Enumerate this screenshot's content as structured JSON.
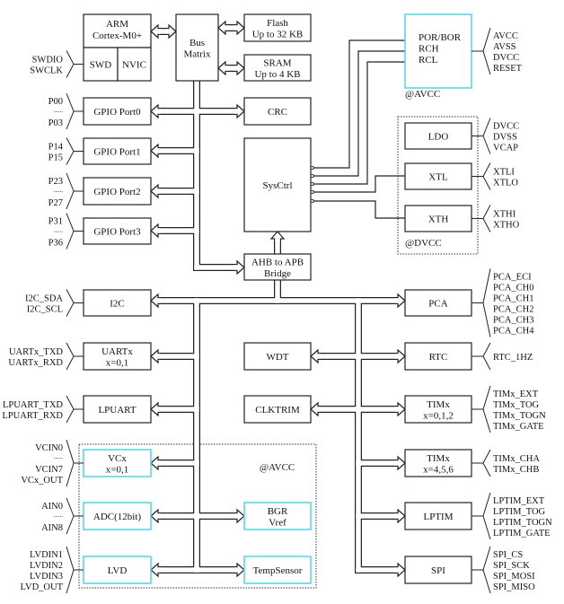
{
  "colors": {
    "line": "#222222",
    "analog_block": "#4fd6e3",
    "background": "#ffffff"
  },
  "blocks": {
    "arm": [
      "ARM",
      "Cortex-M0+"
    ],
    "swd": [
      "SWD"
    ],
    "nvic": [
      "NVIC"
    ],
    "bus_matrix": [
      "Bus",
      "Matrix"
    ],
    "flash": [
      "Flash",
      "Up to 32 KB"
    ],
    "sram": [
      "SRAM",
      "Up to 4 KB"
    ],
    "crc": [
      "CRC"
    ],
    "sysctrl": [
      "SysCtrl"
    ],
    "ahb_apb": [
      "AHB to APB",
      "Bridge"
    ],
    "gpio0": [
      "GPIO Port0"
    ],
    "gpio1": [
      "GPIO Port1"
    ],
    "gpio2": [
      "GPIO Port2"
    ],
    "gpio3": [
      "GPIO Port3"
    ],
    "i2c": [
      "I2C"
    ],
    "uart": [
      "UARTx",
      "x=0,1"
    ],
    "lpuart": [
      "LPUART"
    ],
    "vcx": [
      "VCx",
      "x=0,1"
    ],
    "adc": [
      "ADC(12bit)"
    ],
    "lvd": [
      "LVD"
    ],
    "wdt": [
      "WDT"
    ],
    "clktrim": [
      "CLKTRIM"
    ],
    "bgr": [
      "BGR",
      "Vref"
    ],
    "tempsensor": [
      "TempSensor"
    ],
    "por": [
      "POR/BOR",
      "RCH",
      "RCL"
    ],
    "ldo": [
      "LDO"
    ],
    "xtl": [
      "XTL"
    ],
    "xth": [
      "XTH"
    ],
    "pca": [
      "PCA"
    ],
    "rtc": [
      "RTC"
    ],
    "tim012": [
      "TIMx",
      "x=0,1,2"
    ],
    "tim456": [
      "TIMx",
      "x=4,5,6"
    ],
    "lptim": [
      "LPTIM"
    ],
    "spi": [
      "SPI"
    ]
  },
  "domains": {
    "avcc_top": "@AVCC",
    "dvcc": "@DVCC",
    "avcc_bottom": "@AVCC"
  },
  "pins": {
    "swd": [
      "SWDIO",
      "SWCLK"
    ],
    "gpio0": [
      "P00",
      "......",
      "P03"
    ],
    "gpio1": [
      "P14",
      "P15"
    ],
    "gpio2": [
      "P23",
      "......",
      "P27"
    ],
    "gpio3": [
      "P31",
      "......",
      "P36"
    ],
    "i2c": [
      "I2C_SDA",
      "I2C_SCL"
    ],
    "uart": [
      "UARTx_TXD",
      "UARTx_RXD"
    ],
    "lpuart": [
      "LPUART_TXD",
      "LPUART_RXD"
    ],
    "vcx": [
      "VCIN0",
      "......",
      "VCIN7",
      "VCx_OUT"
    ],
    "adc": [
      "AIN0",
      "......",
      "AIN8"
    ],
    "lvd": [
      "LVDIN1",
      "LVDIN2",
      "LVDIN3",
      "LVD_OUT"
    ],
    "por": [
      "AVCC",
      "AVSS",
      "DVCC",
      "RESET"
    ],
    "ldo": [
      "DVCC",
      "DVSS",
      "VCAP"
    ],
    "xtl": [
      "XTLI",
      "XTLO"
    ],
    "xth": [
      "XTHI",
      "XTHO"
    ],
    "pca": [
      "PCA_ECI",
      "PCA_CH0",
      "PCA_CH1",
      "PCA_CH2",
      "PCA_CH3",
      "PCA_CH4"
    ],
    "rtc": [
      "RTC_1HZ"
    ],
    "tim012": [
      "TIMx_EXT",
      "TIMx_TOG",
      "TIMx_TOGN",
      "TIMx_GATE"
    ],
    "tim456": [
      "TIMx_CHA",
      "TIMx_CHB"
    ],
    "lptim": [
      "LPTIM_EXT",
      "LPTIM_TOG",
      "LPTIM_TOGN",
      "LPTIM_GATE"
    ],
    "spi": [
      "SPI_CS",
      "SPI_SCK",
      "SPI_MOSI",
      "SPI_MISO"
    ]
  }
}
